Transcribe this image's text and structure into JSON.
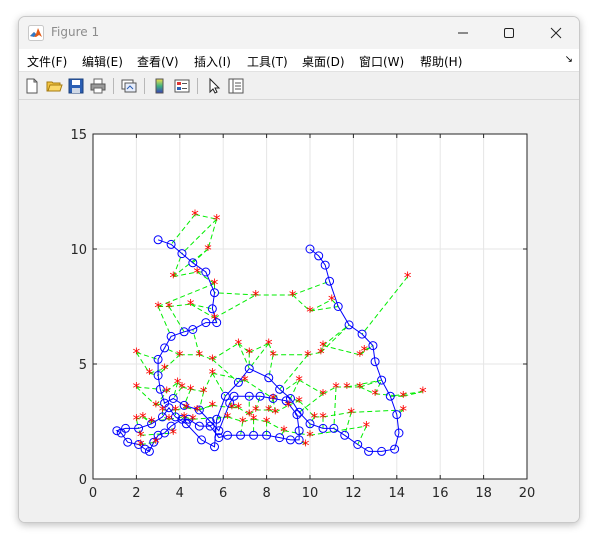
{
  "window": {
    "title": "Figure 1"
  },
  "menu": {
    "items": [
      "文件(F)",
      "编辑(E)",
      "查看(V)",
      "插入(I)",
      "工具(T)",
      "桌面(D)",
      "窗口(W)",
      "帮助(H)"
    ],
    "overflow_icon": "chevron-right-icon"
  },
  "toolbar": {
    "icons": [
      "new-figure-icon",
      "open-file-icon",
      "save-icon",
      "print-icon",
      "link-plot-icon",
      "insert-colorbar-icon",
      "insert-legend-icon",
      "pointer-icon",
      "property-inspector-icon"
    ]
  },
  "colors": {
    "route": "#0000ff",
    "links": "#00ee00",
    "points": "#ff0000",
    "grid": "#e6e6e6"
  },
  "chart_data": {
    "type": "scatter",
    "title": "",
    "xlabel": "",
    "ylabel": "",
    "xlim": [
      0,
      20
    ],
    "ylim": [
      0,
      15
    ],
    "xticks": [
      "0",
      "2",
      "4",
      "6",
      "8",
      "10",
      "12",
      "14",
      "16",
      "18",
      "20"
    ],
    "yticks": [
      "0",
      "5",
      "10",
      "15"
    ],
    "grid": true,
    "series": [
      {
        "style": "blue-circles-solid-line",
        "points": [
          [
            3.0,
            10.4
          ],
          [
            3.6,
            10.2
          ],
          [
            4.1,
            9.8
          ],
          [
            4.6,
            9.4
          ],
          [
            5.2,
            9.0
          ],
          [
            5.6,
            8.1
          ],
          [
            5.5,
            7.4
          ],
          [
            5.7,
            6.8
          ],
          [
            5.2,
            6.8
          ],
          [
            4.6,
            6.5
          ],
          [
            4.2,
            6.4
          ],
          [
            3.6,
            6.2
          ],
          [
            3.3,
            5.7
          ],
          [
            3.0,
            5.2
          ],
          [
            3.0,
            4.5
          ],
          [
            3.1,
            3.9
          ],
          [
            3.3,
            3.3
          ],
          [
            3.7,
            3.5
          ],
          [
            4.2,
            3.2
          ],
          [
            4.9,
            3.0
          ],
          [
            5.4,
            2.5
          ],
          [
            5.8,
            2.1
          ],
          [
            6.3,
            3.3
          ],
          [
            6.5,
            3.6
          ],
          [
            7.2,
            3.6
          ],
          [
            7.7,
            3.6
          ],
          [
            8.3,
            3.5
          ],
          [
            8.9,
            3.4
          ],
          [
            9.4,
            2.8
          ],
          [
            9.5,
            2.1
          ],
          [
            9.5,
            1.7
          ],
          [
            9.1,
            1.7
          ],
          [
            8.6,
            1.8
          ],
          [
            8.0,
            1.9
          ],
          [
            7.4,
            1.9
          ],
          [
            6.8,
            1.9
          ],
          [
            6.2,
            1.9
          ],
          [
            5.8,
            1.8
          ],
          [
            5.4,
            2.3
          ],
          [
            4.9,
            2.3
          ],
          [
            4.4,
            2.6
          ],
          [
            4.1,
            2.6
          ],
          [
            3.6,
            2.3
          ],
          [
            3.3,
            2.0
          ],
          [
            3.0,
            1.9
          ],
          [
            2.8,
            1.6
          ],
          [
            2.6,
            1.2
          ],
          [
            2.4,
            1.3
          ],
          [
            2.1,
            1.5
          ],
          [
            1.6,
            1.6
          ],
          [
            1.3,
            2.0
          ],
          [
            1.1,
            2.1
          ],
          [
            1.5,
            2.2
          ],
          [
            2.1,
            2.2
          ],
          [
            2.7,
            2.4
          ],
          [
            3.2,
            2.7
          ],
          [
            3.5,
            3.1
          ],
          [
            3.8,
            2.7
          ],
          [
            4.3,
            2.4
          ],
          [
            5.0,
            1.7
          ],
          [
            5.6,
            1.4
          ],
          [
            5.7,
            2.6
          ],
          [
            6.1,
            3.6
          ],
          [
            6.7,
            4.2
          ],
          [
            7.2,
            4.8
          ],
          [
            8.1,
            4.4
          ],
          [
            8.6,
            3.9
          ],
          [
            9.1,
            3.5
          ],
          [
            9.5,
            2.9
          ],
          [
            10.0,
            2.4
          ],
          [
            10.6,
            2.2
          ],
          [
            11.1,
            2.2
          ],
          [
            11.6,
            1.9
          ],
          [
            12.2,
            1.5
          ],
          [
            12.7,
            1.2
          ],
          [
            13.3,
            1.2
          ],
          [
            13.9,
            1.3
          ],
          [
            14.1,
            2.0
          ],
          [
            14.0,
            2.8
          ],
          [
            13.7,
            3.6
          ],
          [
            13.3,
            4.3
          ],
          [
            13.0,
            5.1
          ],
          [
            12.9,
            5.8
          ],
          [
            12.4,
            6.3
          ],
          [
            11.8,
            6.7
          ],
          [
            11.3,
            7.5
          ],
          [
            10.9,
            8.6
          ],
          [
            10.7,
            9.3
          ],
          [
            10.4,
            9.7
          ],
          [
            10.0,
            10.0
          ]
        ]
      },
      {
        "style": "red-asterisks",
        "points": [
          [
            4.7,
            11.5
          ],
          [
            5.7,
            11.3
          ],
          [
            5.3,
            10.0
          ],
          [
            3.7,
            8.8
          ],
          [
            4.8,
            9.0
          ],
          [
            5.6,
            8.5
          ],
          [
            3.0,
            7.5
          ],
          [
            3.5,
            7.5
          ],
          [
            4.5,
            7.6
          ],
          [
            5.6,
            7.0
          ],
          [
            7.5,
            8.0
          ],
          [
            9.2,
            8.0
          ],
          [
            10.0,
            7.3
          ],
          [
            11.0,
            7.8
          ],
          [
            14.5,
            8.8
          ],
          [
            2.0,
            5.5
          ],
          [
            2.6,
            4.6
          ],
          [
            3.3,
            4.8
          ],
          [
            4.0,
            5.4
          ],
          [
            4.9,
            5.4
          ],
          [
            5.5,
            5.2
          ],
          [
            6.7,
            5.9
          ],
          [
            7.2,
            5.5
          ],
          [
            8.1,
            5.9
          ],
          [
            8.3,
            5.4
          ],
          [
            9.9,
            5.4
          ],
          [
            10.5,
            5.5
          ],
          [
            10.6,
            5.8
          ],
          [
            12.3,
            5.4
          ],
          [
            12.5,
            5.6
          ],
          [
            2.0,
            4.0
          ],
          [
            2.9,
            3.2
          ],
          [
            3.4,
            3.8
          ],
          [
            3.9,
            4.2
          ],
          [
            4.1,
            4.0
          ],
          [
            4.5,
            3.9
          ],
          [
            5.1,
            3.8
          ],
          [
            5.5,
            4.6
          ],
          [
            7.0,
            4.3
          ],
          [
            8.3,
            3.5
          ],
          [
            9.5,
            4.3
          ],
          [
            10.6,
            3.7
          ],
          [
            11.2,
            4.0
          ],
          [
            11.7,
            4.0
          ],
          [
            12.3,
            4.0
          ],
          [
            13.0,
            3.7
          ],
          [
            14.3,
            3.6
          ],
          [
            15.2,
            3.8
          ],
          [
            3.2,
            3.0
          ],
          [
            3.8,
            3.0
          ],
          [
            4.3,
            3.1
          ],
          [
            4.8,
            3.0
          ],
          [
            5.5,
            3.2
          ],
          [
            6.4,
            3.1
          ],
          [
            6.7,
            3.1
          ],
          [
            7.2,
            2.8
          ],
          [
            7.5,
            3.0
          ],
          [
            8.1,
            3.0
          ],
          [
            8.4,
            2.9
          ],
          [
            9.0,
            3.2
          ],
          [
            9.5,
            3.4
          ],
          [
            10.2,
            2.7
          ],
          [
            10.6,
            2.7
          ],
          [
            11.9,
            2.9
          ],
          [
            14.3,
            3.0
          ],
          [
            2.0,
            2.6
          ],
          [
            2.3,
            2.7
          ],
          [
            2.7,
            2.5
          ],
          [
            3.5,
            2.6
          ],
          [
            4.2,
            2.7
          ],
          [
            4.6,
            2.6
          ],
          [
            6.2,
            2.7
          ],
          [
            6.9,
            2.5
          ],
          [
            7.4,
            2.6
          ],
          [
            8.0,
            2.5
          ],
          [
            8.8,
            2.1
          ],
          [
            10.0,
            1.9
          ],
          [
            12.6,
            2.3
          ],
          [
            2.2,
            1.9
          ],
          [
            3.7,
            2.0
          ],
          [
            9.8,
            1.5
          ],
          [
            2.2,
            1.5
          ],
          [
            2.9,
            1.6
          ]
        ]
      }
    ]
  }
}
